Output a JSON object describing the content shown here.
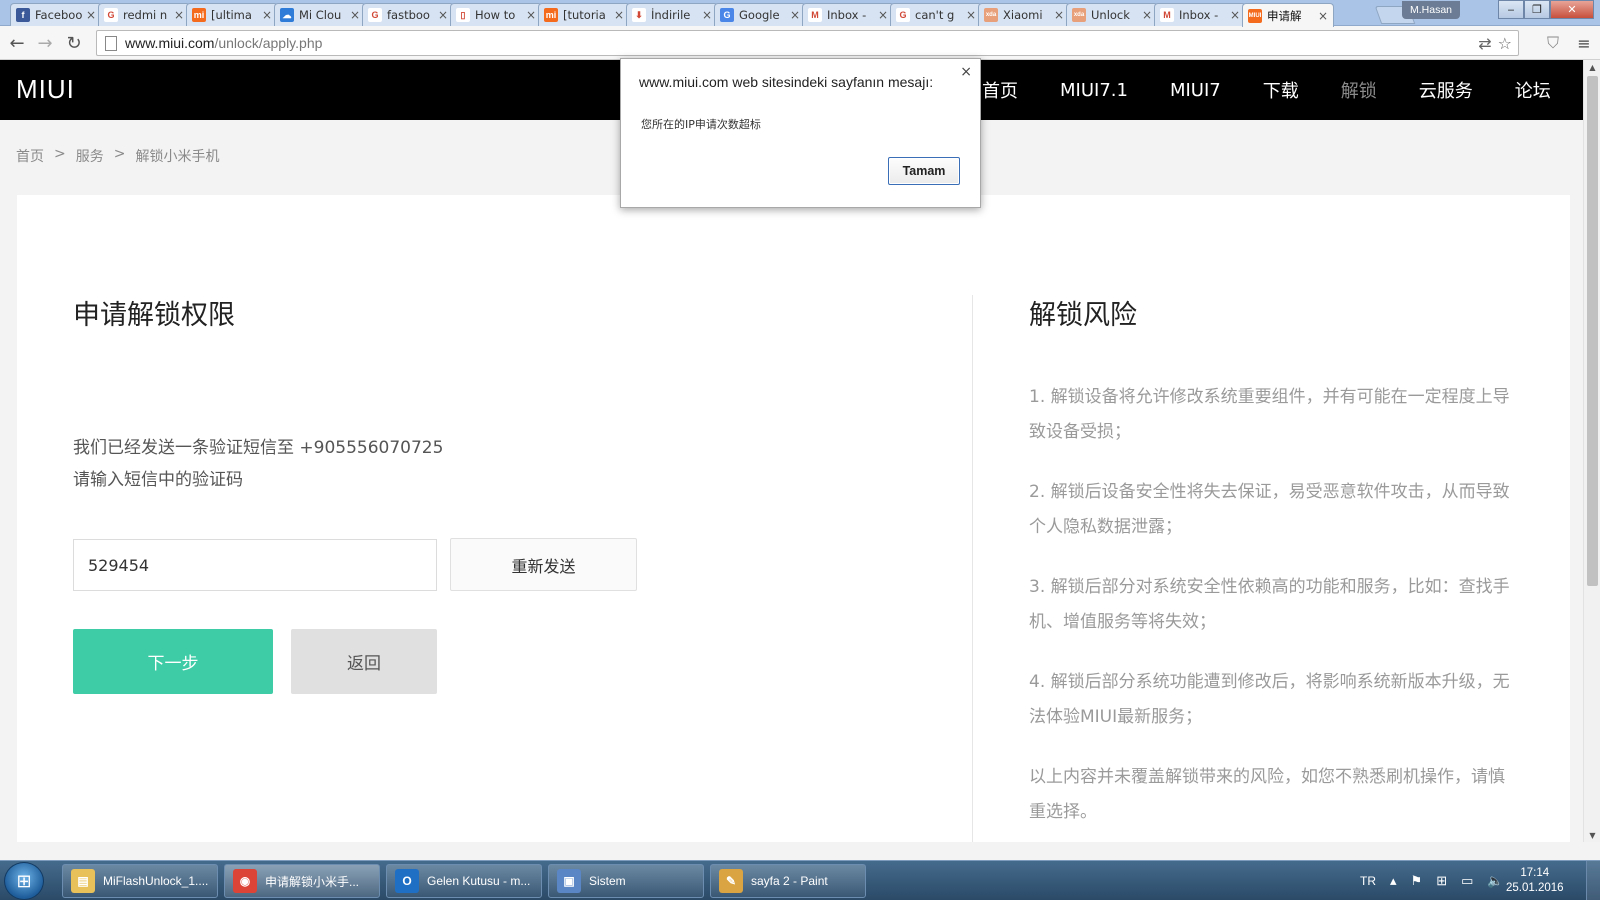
{
  "browser": {
    "tabs": [
      {
        "title": "Faceboo",
        "icon": "facebook-icon",
        "color": "#3b5998",
        "glyph": "f"
      },
      {
        "title": "redmi n",
        "icon": "google-icon",
        "color": "#ffffff",
        "glyph": "G"
      },
      {
        "title": "[ultima",
        "icon": "miui-icon",
        "color": "#f56b1e",
        "glyph": "mi"
      },
      {
        "title": "Mi Clou",
        "icon": "mi-cloud-icon",
        "color": "#2f7bd8",
        "glyph": "☁"
      },
      {
        "title": "fastboo",
        "icon": "google-icon",
        "color": "#ffffff",
        "glyph": "G"
      },
      {
        "title": "How to",
        "icon": "page-icon",
        "color": "#ffffff",
        "glyph": "▯"
      },
      {
        "title": "[tutoria",
        "icon": "miui-icon",
        "color": "#f56b1e",
        "glyph": "mi"
      },
      {
        "title": "İndirile",
        "icon": "download-icon",
        "color": "#ffffff",
        "glyph": "⬇"
      },
      {
        "title": "Google",
        "icon": "google-translate-icon",
        "color": "#4a86e8",
        "glyph": "G"
      },
      {
        "title": "Inbox -",
        "icon": "gmail-icon",
        "color": "#ffffff",
        "glyph": "M"
      },
      {
        "title": "can't g",
        "icon": "google-icon",
        "color": "#ffffff",
        "glyph": "G"
      },
      {
        "title": "Xiaomi",
        "icon": "xda-icon",
        "color": "#e8a07a",
        "glyph": "xda"
      },
      {
        "title": "Unlock",
        "icon": "xda-icon",
        "color": "#e8a07a",
        "glyph": "xda"
      },
      {
        "title": "Inbox -",
        "icon": "gmail-icon",
        "color": "#ffffff",
        "glyph": "M"
      },
      {
        "title": "申请解",
        "icon": "miui-icon",
        "color": "#f56b1e",
        "glyph": "MIUI",
        "active": true
      }
    ],
    "profile_name": "M.Hasan",
    "url_host": "www.miui.com",
    "url_path": "/unlock/apply.php"
  },
  "site": {
    "logo": "MIUI",
    "nav": [
      {
        "label": "首页"
      },
      {
        "label": "MIUI7.1"
      },
      {
        "label": "MIUI7"
      },
      {
        "label": "下载"
      },
      {
        "label": "解锁",
        "active": true
      },
      {
        "label": "云服务"
      },
      {
        "label": "论坛"
      }
    ],
    "breadcrumb": [
      "首页",
      "服务",
      "解锁小米手机"
    ],
    "breadcrumb_separator": ">"
  },
  "apply": {
    "title": "申请解锁权限",
    "sms_line1": "我们已经发送一条验证短信至 +905556070725",
    "sms_line2": "请输入短信中的验证码",
    "code_value": "529454",
    "resend_label": "重新发送",
    "next_label": "下一步",
    "back_label": "返回"
  },
  "risk": {
    "title": "解锁风险",
    "items": [
      "1. 解锁设备将允许修改系统重要组件，并有可能在一定程度上导致设备受损；",
      "2. 解锁后设备安全性将失去保证，易受恶意软件攻击，从而导致个人隐私数据泄露；",
      "3. 解锁后部分对系统安全性依赖高的功能和服务，比如：查找手机、增值服务等将失效；",
      "4. 解锁后部分系统功能遭到修改后，将影响系统新版本升级，无法体验MIUI最新服务；",
      "以上内容并未覆盖解锁带来的风险，如您不熟悉刷机操作，请慎重选择。"
    ]
  },
  "alert": {
    "title": "www.miui.com web sitesindeki sayfanın mesajı:",
    "message": "您所在的IP申请次数超标",
    "ok_label": "Tamam",
    "close_glyph": "×"
  },
  "taskbar": {
    "tasks": [
      {
        "label": "MiFlashUnlock_1....",
        "icon": "folder-icon",
        "color": "#e8c15a",
        "glyph": "▤"
      },
      {
        "label": "申请解锁小米手...",
        "icon": "chrome-icon",
        "color": "#db4437",
        "glyph": "◉",
        "active": true
      },
      {
        "label": "Gelen Kutusu - m...",
        "icon": "outlook-icon",
        "color": "#1f6fc5",
        "glyph": "O"
      },
      {
        "label": "Sistem",
        "icon": "system-icon",
        "color": "#5b86c6",
        "glyph": "▣"
      },
      {
        "label": "sayfa 2 - Paint",
        "icon": "paint-icon",
        "color": "#d9a441",
        "glyph": "✎"
      }
    ],
    "language": "TR",
    "time": "17:14",
    "date": "25.01.2016"
  },
  "colors": {
    "accent": "#3ecca6",
    "header_bg": "#000000",
    "nav_active": "#8a8a8a"
  }
}
